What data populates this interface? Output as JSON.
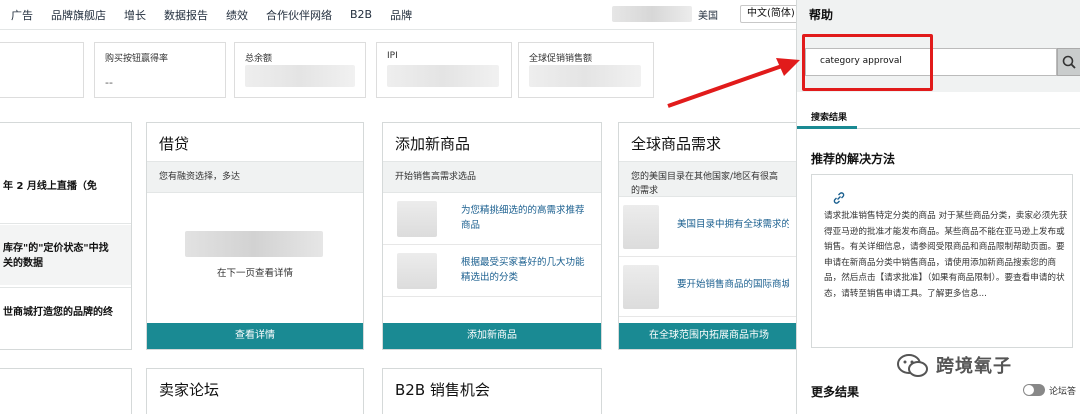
{
  "topnav": {
    "items": [
      "广告",
      "品牌旗舰店",
      "增长",
      "数据报告",
      "绩效",
      "合作伙伴网络",
      "B2B",
      "品牌"
    ],
    "marketplace": "美国",
    "language": "中文(简体)"
  },
  "metrics": [
    {
      "label": "购买按钮赢得率",
      "value": "--"
    },
    {
      "label": "总余额",
      "value": ""
    },
    {
      "label": "IPI",
      "value": ""
    },
    {
      "label": "全球促销销售额",
      "value": ""
    }
  ],
  "left_card": {
    "lines": [
      "年 2 月线上直播（免",
      "库存\"的\"定价状态\"中找",
      "关的数据",
      "世商城打造您的品牌的终"
    ]
  },
  "loan_card": {
    "title": "借贷",
    "subtitle": "您有融资选择，多达",
    "note": "在下一页查看详情",
    "button": "查看详情"
  },
  "add_product_card": {
    "title": "添加新商品",
    "subtitle": "开始销售高需求选品",
    "rows": [
      "为您精挑细选的的高需求推荐商品",
      "根据最受买家喜好的几大功能精选出的分类"
    ],
    "button": "添加新商品"
  },
  "global_demand_card": {
    "title": "全球商品需求",
    "subtitle": "您的美国目录在其他国家/地区有很高的需求",
    "rows": [
      "美国目录中拥有全球需求的商品",
      "要开始销售商品的国际商城"
    ],
    "button": "在全球范围内拓展商品市场"
  },
  "bottom_cards": [
    {
      "title": "卖家论坛"
    },
    {
      "title": "B2B 销售机会"
    }
  ],
  "help": {
    "title": "帮助",
    "search_value": "category approval",
    "results_label": "搜索结果",
    "recommended_title": "推荐的解决方法",
    "recommended_body": "请求批准销售特定分类的商品 对于某些商品分类，卖家必须先获得亚马逊的批准才能发布商品。某些商品不能在亚马逊上发布或销售。有关详细信息，请参阅受限商品和商品限制帮助页面。要申请在新商品分类中销售商品，请使用添加新商品搜索您的商品，然后点击【请求批准】（如果有商品限制）。要查看申请的状态，请转至销售申请工具。了解更多信息...",
    "more_results": "更多结果",
    "forum_label": "论坛答"
  },
  "watermark": "跨境氧子",
  "colors": {
    "accent_teal": "#1a8a93",
    "highlight_red": "#e11b1b",
    "link_blue": "#1a5f8f"
  }
}
